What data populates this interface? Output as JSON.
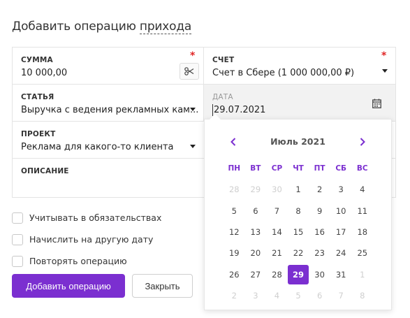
{
  "header": {
    "title_prefix": "Добавить операцию",
    "title_type": "прихода"
  },
  "form": {
    "amount": {
      "label": "СУММА",
      "value": "10 000,00",
      "required": "*"
    },
    "account": {
      "label": "СЧЕТ",
      "value": "Счет в Сбере (1 000 000,00 ₽)",
      "required": "*"
    },
    "category": {
      "label": "СТАТЬЯ",
      "value": "Выручка с ведения рекламных кам..."
    },
    "date": {
      "label": "ДАТА",
      "value": "29.07.2021"
    },
    "project": {
      "label": "ПРОЕКТ",
      "value": "Реклама для какого-то клиента"
    },
    "description": {
      "label": "ОПИСАНИЕ",
      "value": ""
    }
  },
  "checkboxes": [
    {
      "label": "Учитывать в обязательствах",
      "checked": false
    },
    {
      "label": "Начислить на другую дату",
      "checked": false
    },
    {
      "label": "Повторять операцию",
      "checked": false
    }
  ],
  "buttons": {
    "submit": "Добавить операцию",
    "close": "Закрыть"
  },
  "calendar": {
    "month_label": "Июль 2021",
    "weekdays": [
      "ПН",
      "ВТ",
      "СР",
      "ЧТ",
      "ПТ",
      "СБ",
      "ВС"
    ],
    "weeks": [
      [
        {
          "d": "28",
          "m": true
        },
        {
          "d": "29",
          "m": true
        },
        {
          "d": "30",
          "m": true
        },
        {
          "d": "1"
        },
        {
          "d": "2"
        },
        {
          "d": "3"
        },
        {
          "d": "4"
        }
      ],
      [
        {
          "d": "5"
        },
        {
          "d": "6"
        },
        {
          "d": "7"
        },
        {
          "d": "8"
        },
        {
          "d": "9"
        },
        {
          "d": "10"
        },
        {
          "d": "11"
        }
      ],
      [
        {
          "d": "12"
        },
        {
          "d": "13"
        },
        {
          "d": "14"
        },
        {
          "d": "15"
        },
        {
          "d": "16"
        },
        {
          "d": "17"
        },
        {
          "d": "18"
        }
      ],
      [
        {
          "d": "19"
        },
        {
          "d": "20"
        },
        {
          "d": "21"
        },
        {
          "d": "22"
        },
        {
          "d": "23"
        },
        {
          "d": "24"
        },
        {
          "d": "25"
        }
      ],
      [
        {
          "d": "26"
        },
        {
          "d": "27"
        },
        {
          "d": "28"
        },
        {
          "d": "29",
          "s": true
        },
        {
          "d": "30"
        },
        {
          "d": "31"
        },
        {
          "d": "1",
          "m": true
        }
      ],
      [
        {
          "d": "2",
          "m": true
        },
        {
          "d": "3",
          "m": true
        },
        {
          "d": "4",
          "m": true
        },
        {
          "d": "5",
          "m": true
        },
        {
          "d": "6",
          "m": true
        },
        {
          "d": "7",
          "m": true
        },
        {
          "d": "8",
          "m": true
        }
      ]
    ]
  },
  "colors": {
    "accent": "#7b2fd0",
    "required": "#e02424",
    "muted": "#cfcfcf"
  },
  "icons": {
    "prev": "chevron-left-icon",
    "next": "chevron-right-icon",
    "calendar": "calendar-icon",
    "split": "scissors-icon"
  }
}
